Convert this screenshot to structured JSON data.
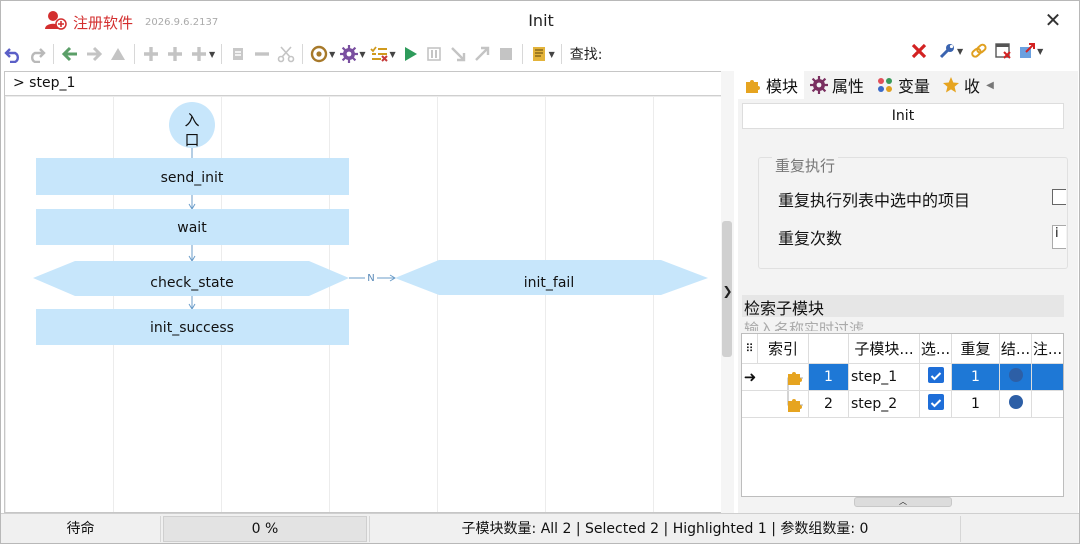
{
  "app": {
    "register_label": "注册软件",
    "version": "2026.9.6.2137",
    "window_title": "Init"
  },
  "toolbar": {
    "find_label": "查找:",
    "find_value": ""
  },
  "canvas": {
    "breadcrumb": "> step_1",
    "nodes": {
      "entry": "入口",
      "send_init": "send_init",
      "wait": "wait",
      "check_state": "check_state",
      "init_success": "init_success",
      "init_fail": "init_fail"
    },
    "edge_label_no": "N"
  },
  "right_panel": {
    "tabs": [
      {
        "label": "模块",
        "icon": "puzzle-icon"
      },
      {
        "label": "属性",
        "icon": "gear-icon"
      },
      {
        "label": "变量",
        "icon": "variables-icon"
      },
      {
        "label": "收",
        "icon": "star-icon"
      }
    ],
    "module_name": "Init",
    "repeat_group_title": "重复执行",
    "repeat_selected_label": "重复执行列表中选中的项目",
    "repeat_count_label": "重复次数",
    "repeat_count_value": "i",
    "search_title": "检索子模块",
    "search_placeholder": "输入名称实时过滤",
    "table": {
      "headers": [
        "索引",
        "子模块...",
        "选...",
        "重复",
        "结...",
        "注..."
      ],
      "rows": [
        {
          "index": "1",
          "name": "step_1",
          "selected": true,
          "repeat": "1",
          "current": true
        },
        {
          "index": "2",
          "name": "step_2",
          "selected": true,
          "repeat": "1",
          "current": false
        }
      ]
    }
  },
  "status": {
    "state": "待命",
    "progress": "0 %",
    "summary": "子模块数量: All 2 | Selected 2 | Highlighted 1 | 参数组数量: 0"
  },
  "colors": {
    "accent": "#1e78d6",
    "node_fill": "#c7e6fb",
    "register_red": "#d32f2f"
  }
}
